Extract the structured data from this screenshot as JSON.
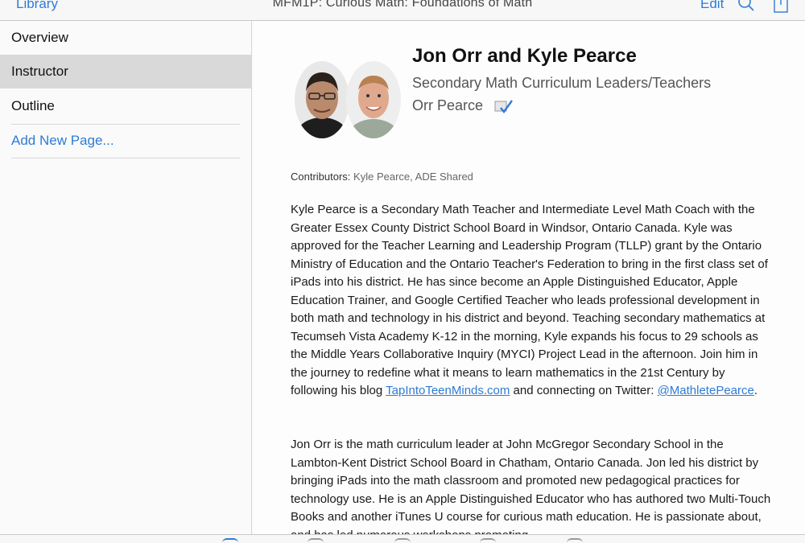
{
  "nav": {
    "back_label": "Library",
    "title": "MFM1P: Curious Math: Foundations of Math",
    "edit_label": "Edit",
    "search_icon": "search-icon",
    "share_icon": "share-icon",
    "accent_color": "#2f7bd4"
  },
  "sidebar": {
    "items": [
      {
        "label": "Overview"
      },
      {
        "label": "Instructor",
        "selected": true
      },
      {
        "label": "Outline"
      }
    ],
    "add_page_label": "Add New Page..."
  },
  "instructor": {
    "name": "Jon Orr and Kyle Pearce",
    "subtitle": "Secondary Math Curriculum Leaders/Teachers",
    "organization": "Orr Pearce",
    "organization_icon": "itunes-u-icon",
    "contributors_label": "Contributors:",
    "contributors_value": "Kyle Pearce, ADE Shared"
  },
  "bio": {
    "kyle_text": "Kyle Pearce is a Secondary Math Teacher and Intermediate Level Math Coach with the Greater Essex County District School Board in Windsor, Ontario Canada. Kyle was approved for the Teacher Learning and Leadership Program (TLLP) grant by the Ontario Ministry of Education and the Ontario Teacher's Federation to bring in the first class set of iPads into his district. He has since become an Apple Distinguished Educator, Apple Education Trainer, and Google Certified Teacher who leads professional development in both math and technology in his district and beyond. Teaching secondary mathematics at Tecumseh Vista Academy K-12 in the morning, Kyle expands his focus to 29 schools as the Middle Years Collaborative Inquiry (MYCI) Project Lead in the afternoon. Join him in the journey to redefine what it means to learn mathematics in the 21st Century by following his blog ",
    "kyle_link_blog": "TapIntoTeenMinds.com",
    "kyle_mid": " and connecting on Twitter: ",
    "kyle_link_twitter": "@MathletePearce",
    "kyle_end": ".",
    "jon_text": "Jon Orr is the math curriculum leader at John McGregor Secondary School in the Lambton-Kent District School Board in Chatham, Ontario Canada. Jon led his district by bringing iPads into the math classroom and promoted new pedagogical practices for technology use. He is an Apple Distinguished Educator who has authored two Multi-Touch Books and another iTunes U course for curious math education. He is passionate about, and has led numerous workshops promoting"
  },
  "tabbar": {
    "icons": [
      "course-tab-icon",
      "posts-tab-icon",
      "materials-tab-icon",
      "notes-tab-icon",
      "more-tab-icon"
    ]
  }
}
